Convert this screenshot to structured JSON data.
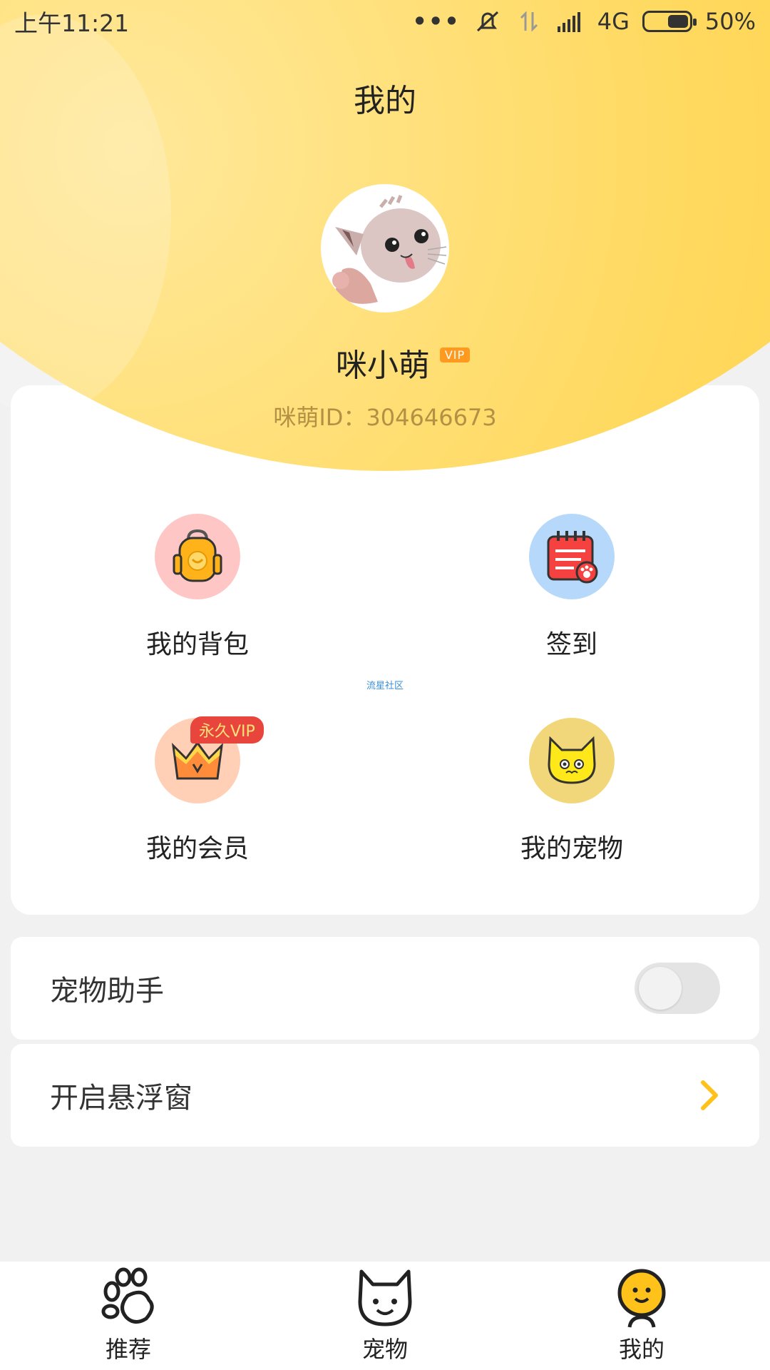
{
  "status_bar": {
    "time": "上午11:21",
    "dots": "•••",
    "network": "4G",
    "battery": "50%"
  },
  "header": {
    "title": "我的",
    "username": "咪小萌",
    "vip_badge": "VIP",
    "user_id": "咪萌ID：304646673"
  },
  "grid": {
    "items": [
      {
        "label": "我的背包",
        "icon": "backpack-icon"
      },
      {
        "label": "签到",
        "icon": "calendar-icon"
      },
      {
        "label": "我的会员",
        "icon": "crown-icon",
        "tag": "永久VIP"
      },
      {
        "label": "我的宠物",
        "icon": "cat-face-icon"
      }
    ],
    "watermark": "流星社区"
  },
  "rows": {
    "assistant_label": "宠物助手",
    "float_window_label": "开启悬浮窗"
  },
  "nav": {
    "items": [
      {
        "label": "推荐",
        "icon": "paw-icon"
      },
      {
        "label": "宠物",
        "icon": "cat-icon"
      },
      {
        "label": "我的",
        "icon": "profile-icon"
      }
    ]
  },
  "colors": {
    "accent": "#ffd34d",
    "vip_orange": "#ff9a1f",
    "vip_tag_red": "#e8463c",
    "arrow": "#ffc21a"
  }
}
